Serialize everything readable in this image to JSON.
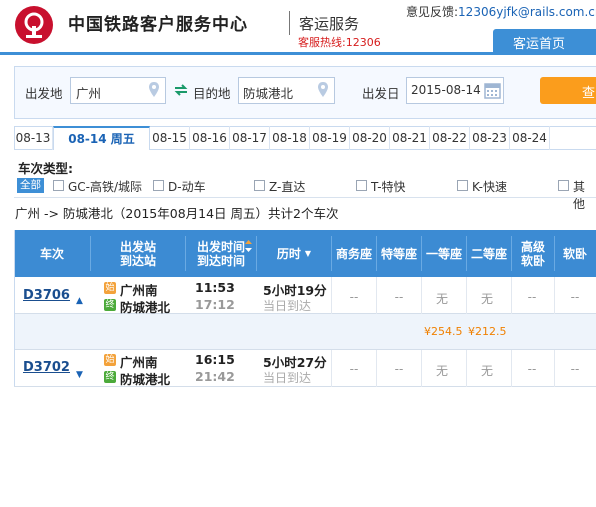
{
  "header": {
    "site_title": "中国铁路客户服务中心",
    "service_title": "客运服务",
    "hotline": "客服热线:12306",
    "feedback_label": "意见反馈:",
    "feedback_email": "12306yjfk@rails.com.cn",
    "nav_home": "客运首页"
  },
  "search": {
    "from_label": "出发地",
    "from_value": "广州",
    "to_label": "目的地",
    "to_value": "防城港北",
    "date_label": "出发日",
    "date_value": "2015-08-14",
    "query_button": "查"
  },
  "date_tabs": [
    {
      "label": "08-13",
      "active": false
    },
    {
      "label": "08-14 周五",
      "active": true
    },
    {
      "label": "08-15",
      "active": false
    },
    {
      "label": "08-16",
      "active": false
    },
    {
      "label": "08-17",
      "active": false
    },
    {
      "label": "08-18",
      "active": false
    },
    {
      "label": "08-19",
      "active": false
    },
    {
      "label": "08-20",
      "active": false
    },
    {
      "label": "08-21",
      "active": false
    },
    {
      "label": "08-22",
      "active": false
    },
    {
      "label": "08-23",
      "active": false
    },
    {
      "label": "08-24",
      "active": false
    }
  ],
  "filter": {
    "label": "车次类型:",
    "all": "全部",
    "options": [
      "GC-高铁/城际",
      "D-动车",
      "Z-直达",
      "T-特快",
      "K-快速",
      "其他"
    ]
  },
  "route_info": "广州 -> 防城港北（2015年08月14日  周五）共计2个车次",
  "table": {
    "headers": {
      "train": "车次",
      "stations_1": "出发站",
      "stations_2": "到达站",
      "times_1": "出发时间",
      "times_2": "到达时间",
      "duration": "历时",
      "business": "商务座",
      "special": "特等座",
      "first": "一等座",
      "second": "二等座",
      "soft_sleeper_1": "高级",
      "soft_sleeper_2": "软卧",
      "soft": "软卧"
    },
    "rows": [
      {
        "train": "D3706",
        "from_badge": "始",
        "from": "广州南",
        "to_badge": "终",
        "to": "防城港北",
        "depart": "11:53",
        "arrive": "17:12",
        "duration": "5小时19分",
        "arrival_day": "当日到达",
        "business": "--",
        "special": "--",
        "first": "无",
        "second": "无",
        "high_soft": "--",
        "soft": "--",
        "first_price": "¥254.5",
        "second_price": "¥212.5"
      },
      {
        "train": "D3702",
        "from_badge": "始",
        "from": "广州南",
        "to_badge": "终",
        "to": "防城港北",
        "depart": "16:15",
        "arrive": "21:42",
        "duration": "5小时27分",
        "arrival_day": "当日到达",
        "business": "--",
        "special": "--",
        "first": "无",
        "second": "无",
        "high_soft": "--",
        "soft": "--"
      }
    ]
  },
  "colors": {
    "brand_red": "#c8102e",
    "header_blue": "#3c8bd3",
    "price_orange": "#f08000",
    "query_orange": "#fb9d1c"
  },
  "icons": [
    "railway-logo-icon",
    "location-pin-icon",
    "swap-icon",
    "calendar-icon",
    "sort-arrow-icon",
    "dropdown-arrow-icon"
  ]
}
